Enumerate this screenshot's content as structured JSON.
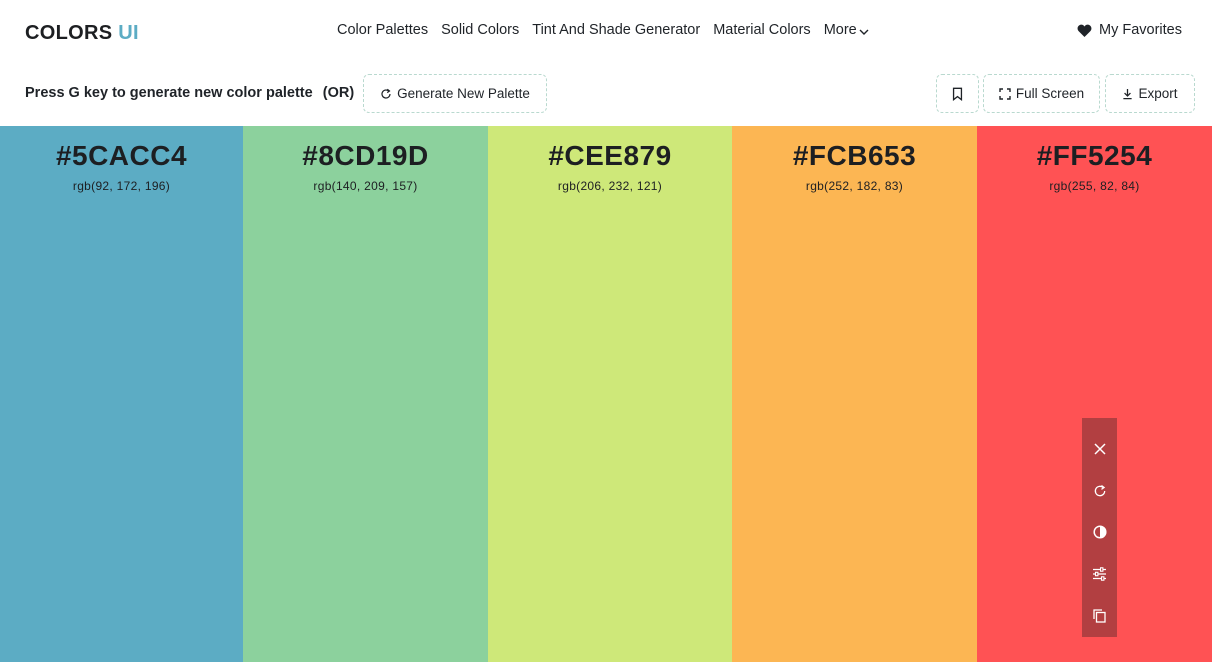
{
  "logo": {
    "main": "COLORS",
    "accent": "UI"
  },
  "nav": {
    "links": [
      "Color Palettes",
      "Solid Colors",
      "Tint And Shade Generator",
      "Material Colors"
    ],
    "more_label": "More"
  },
  "favorites_label": "My Favorites",
  "toolbar": {
    "hint": "Press G key to generate new color palette",
    "or_label": "(OR)",
    "generate_label": "Generate New Palette",
    "fullscreen_label": "Full Screen",
    "export_label": "Export"
  },
  "palette": [
    {
      "hex": "#5CACC4",
      "rgb": "rgb(92, 172, 196)",
      "color": "#5CACC4"
    },
    {
      "hex": "#8CD19D",
      "rgb": "rgb(140, 209, 157)",
      "color": "#8CD19D"
    },
    {
      "hex": "#CEE879",
      "rgb": "rgb(206, 232, 121)",
      "color": "#CEE879"
    },
    {
      "hex": "#FCB653",
      "rgb": "rgb(252, 182, 83)",
      "color": "#FCB653"
    },
    {
      "hex": "#FF5254",
      "rgb": "rgb(255, 82, 84)",
      "color": "#FF5254"
    }
  ],
  "tools": [
    "close-icon",
    "refresh-icon",
    "contrast-icon",
    "sliders-icon",
    "copy-icon"
  ],
  "colors": {
    "tool_panel": "#B23F41",
    "logo_accent": "#5CACC4",
    "button_border": "#B9D9CF"
  }
}
